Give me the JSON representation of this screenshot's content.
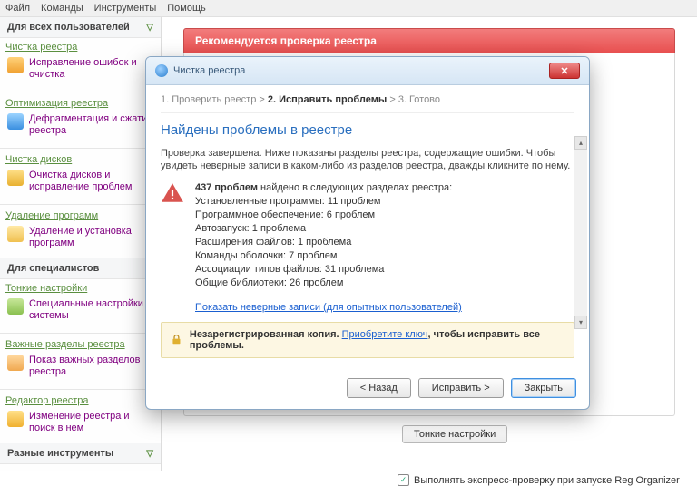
{
  "menubar": [
    "Файл",
    "Команды",
    "Инструменты",
    "Помощь"
  ],
  "sidebar": {
    "group1": "Для всех пользователей",
    "sections": [
      {
        "title": "Чистка реестра",
        "link": "Исправление ошибок и очистка"
      },
      {
        "title": "Оптимизация реестра",
        "link": "Дефрагментация и сжатие реестра"
      },
      {
        "title": "Чистка дисков",
        "link": "Очистка дисков и исправление проблем"
      },
      {
        "title": "Удаление программ",
        "link": "Удаление и установка программ"
      }
    ],
    "group2": "Для специалистов",
    "sections2": [
      {
        "title": "Тонкие настройки",
        "link": "Специальные настройки системы"
      },
      {
        "title": "Важные разделы реестра",
        "link": "Показ важных разделов реестра"
      },
      {
        "title": "Редактор реестра",
        "link": "Изменение реестра и поиск в нем"
      }
    ],
    "group3": "Разные инструменты"
  },
  "content": {
    "redbar": "Рекомендуется проверка реестра",
    "thin_btn": "Тонкие настройки",
    "checkbox": "Выполнять экспресс-проверку при запуске Reg Organizer"
  },
  "dialog": {
    "title": "Чистка реестра",
    "crumb1": "1. Проверить реестр",
    "crumb2": "2. Исправить проблемы",
    "crumb3": "3. Готово",
    "heading": "Найдены проблемы в реестре",
    "intro": "Проверка завершена. Ниже показаны разделы реестра, содержащие ошибки. Чтобы увидеть неверные записи в каком-либо из разделов реестра, дважды кликните по нему.",
    "lead_count": "437 проблем",
    "lead_rest": " найдено в следующих разделах реестра:",
    "items": [
      "Установленные программы: 11 проблем",
      "Программное обеспечение: 6 проблем",
      "Автозапуск: 1 проблема",
      "Расширения файлов: 1 проблема",
      "Команды оболочки: 7 проблем",
      "Ассоциации типов файлов: 31 проблема",
      "Общие библиотеки: 26 проблем"
    ],
    "advanced_link": "Показать неверные записи (для опытных пользователей)",
    "notice_pre": "Незарегистрированная копия. ",
    "notice_link": "Приобретите ключ",
    "notice_post": ", чтобы исправить все проблемы.",
    "btn_back": "< Назад",
    "btn_fix": "Исправить >",
    "btn_close": "Закрыть"
  }
}
